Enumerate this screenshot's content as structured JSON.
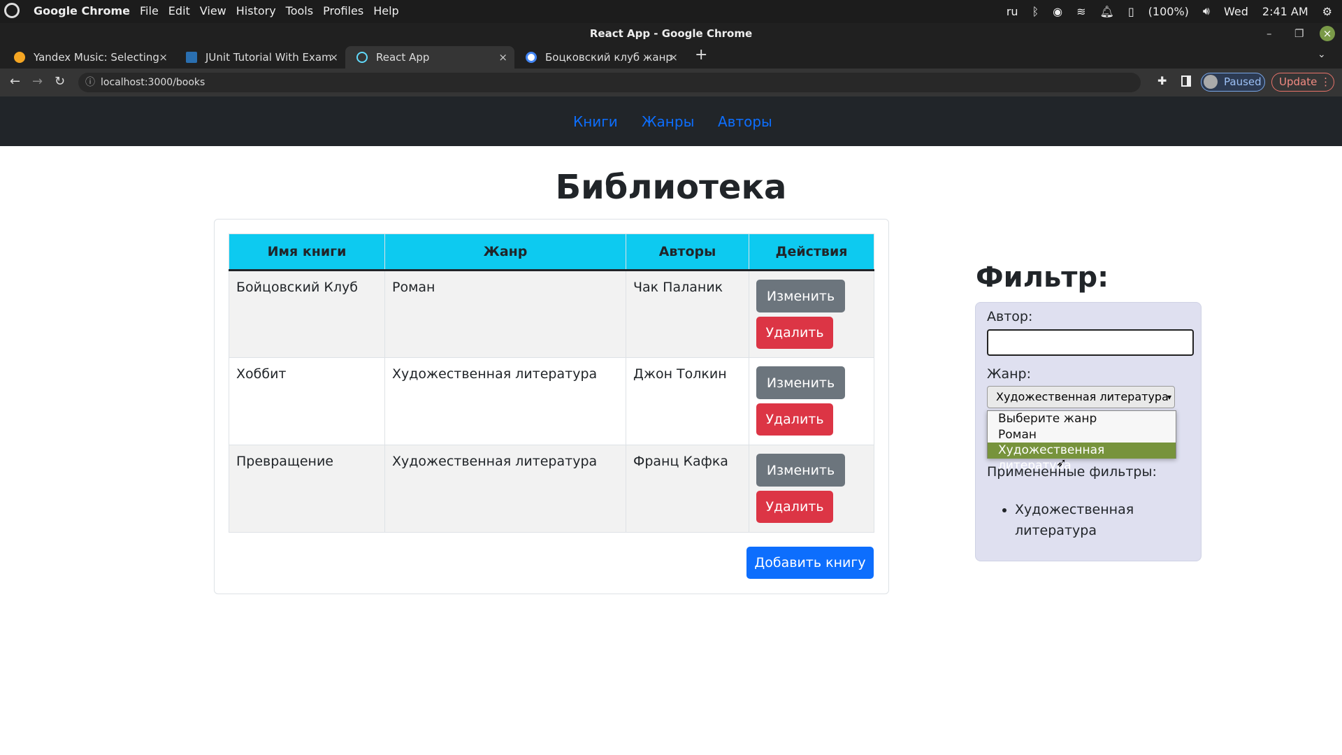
{
  "os": {
    "app": "Google Chrome",
    "menu": [
      "File",
      "Edit",
      "View",
      "History",
      "Tools",
      "Profiles",
      "Help"
    ],
    "tray": {
      "lang": "ru",
      "battery": "(100%)",
      "day": "Wed",
      "time": "2:41 AM"
    }
  },
  "window": {
    "title": "React App - Google Chrome"
  },
  "tabs": [
    {
      "label": "Yandex Music: Selecting",
      "icon": "yandex-music-icon"
    },
    {
      "label": "JUnit Tutorial With Exam",
      "icon": "junit-icon"
    },
    {
      "label": "React App",
      "icon": "react-icon",
      "active": true
    },
    {
      "label": "Боцковский клуб жанр",
      "icon": "google-icon"
    }
  ],
  "address": {
    "url": "localhost:3000/books",
    "profile": "Paused",
    "update": "Update"
  },
  "nav": {
    "links": [
      "Книги",
      "Жанры",
      "Авторы"
    ],
    "color": "#0d6efd"
  },
  "page": {
    "title": "Библиотека"
  },
  "table": {
    "headers": [
      "Имя книги",
      "Жанр",
      "Авторы",
      "Действия"
    ],
    "rows": [
      {
        "name": "Бойцовский Клуб",
        "genre": "Роман",
        "author": "Чак Паланик"
      },
      {
        "name": "Хоббит",
        "genre": "Художественная литература",
        "author": "Джон Толкин"
      },
      {
        "name": "Превращение",
        "genre": "Художественная литература",
        "author": "Франц Кафка"
      }
    ],
    "edit_label": "Изменить",
    "delete_label": "Удалить",
    "header_color": "#0dcaf0"
  },
  "add_button": "Добавить книгу",
  "filter": {
    "title": "Фильтр:",
    "author_label": "Автор:",
    "author_value": "",
    "genre_label": "Жанр:",
    "genre_selected": "Художественная литература",
    "options": [
      "Выберите жанр",
      "Роман",
      "Художественная литература"
    ],
    "applied_label": "Примененные фильтры:",
    "applied": [
      "Художественная литература"
    ]
  }
}
